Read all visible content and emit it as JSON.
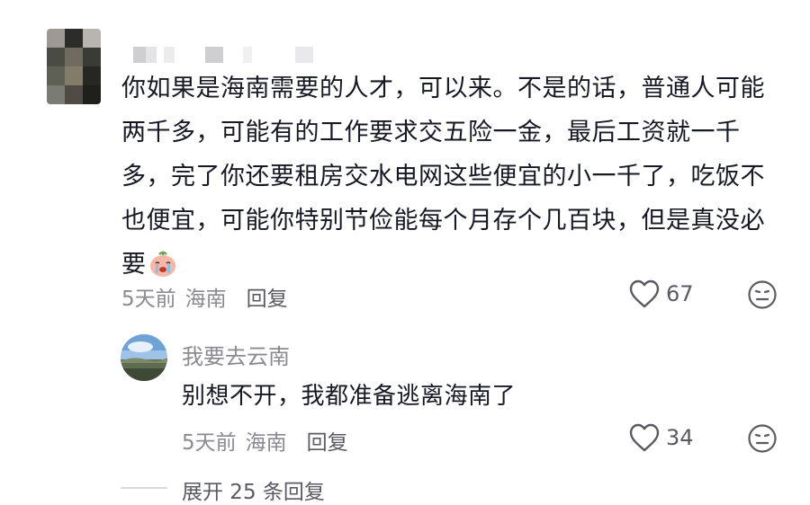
{
  "comment": {
    "text": "你如果是海南需要的人才，可以来。不是的话，普通人可能两千多，可能有的工作要求交五险一金，最后工资就一千多，完了你还要租房交水电网这些便宜的小一千了，吃饭不也便宜，可能你特别节俭能每个月存个几百块，但是真没必要",
    "emoji_icon": "crying-face-icon",
    "time": "5天前",
    "location": "海南",
    "reply_label": "回复",
    "likes": "67"
  },
  "reply": {
    "username": "我要去云南",
    "text": "别想不开，我都准备逃离海南了",
    "time": "5天前",
    "location": "海南",
    "reply_label": "回复",
    "likes": "34"
  },
  "expand": {
    "label": "展开 25 条回复"
  },
  "colors": {
    "text_primary": "#161823",
    "text_secondary": "#8a8b91",
    "icon": "#5a5b62"
  }
}
